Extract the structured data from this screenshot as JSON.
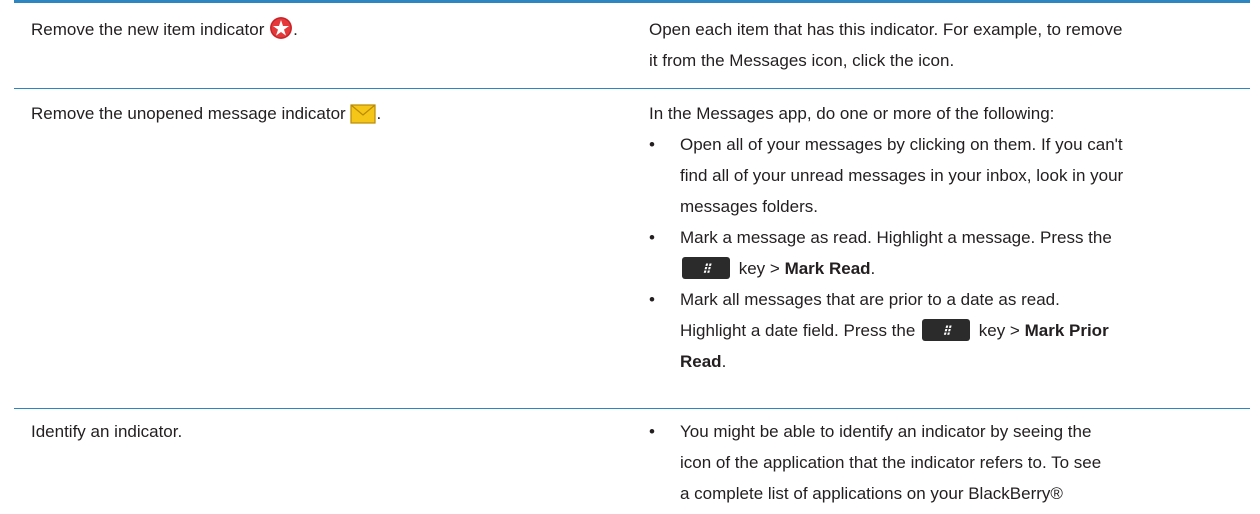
{
  "colors": {
    "rule": "#2e86c1",
    "indicator_red": "#e5383b",
    "envelope": "#f5c518",
    "key_bg": "#2b2b2b"
  },
  "rows": [
    {
      "action": "Remove the new item indicator",
      "action_suffix": ".",
      "icon": "new-item-star-icon",
      "result_line1": "Open each item that has this indicator. For example, to remove",
      "result_line2": "it from the Messages icon, click the icon."
    },
    {
      "action": "Remove the unopened message indicator",
      "action_suffix": ".",
      "icon": "envelope-icon",
      "intro": "In the Messages app, do one or more of the following:",
      "bullets": [
        {
          "line1": "Open all of your messages by clicking on them. If you can't",
          "line2": "find all of your unread messages in your inbox, look in your",
          "line3": "messages folders."
        },
        {
          "line1": "Mark a message as read. Highlight a message. Press the",
          "line2_after_key": " key > ",
          "line2_bold": "Mark Read",
          "line2_end": "."
        },
        {
          "line1": "Mark all messages that are prior to a date as read.",
          "line2_pre": "Highlight a date field. Press the ",
          "line2_after_key": " key > ",
          "line2_bold": "Mark Prior",
          "line3_bold": "Read",
          "line3_end": "."
        }
      ]
    },
    {
      "action": "Identify an indicator.",
      "bullets": [
        {
          "line1": "You might be able to identify an indicator by seeing the",
          "line2": "icon of the application that the indicator refers to. To see",
          "line3": "a complete list of applications on your BlackBerry®"
        }
      ]
    }
  ],
  "bullet_char": "•",
  "menu_key_glyph": "⁝⁝"
}
